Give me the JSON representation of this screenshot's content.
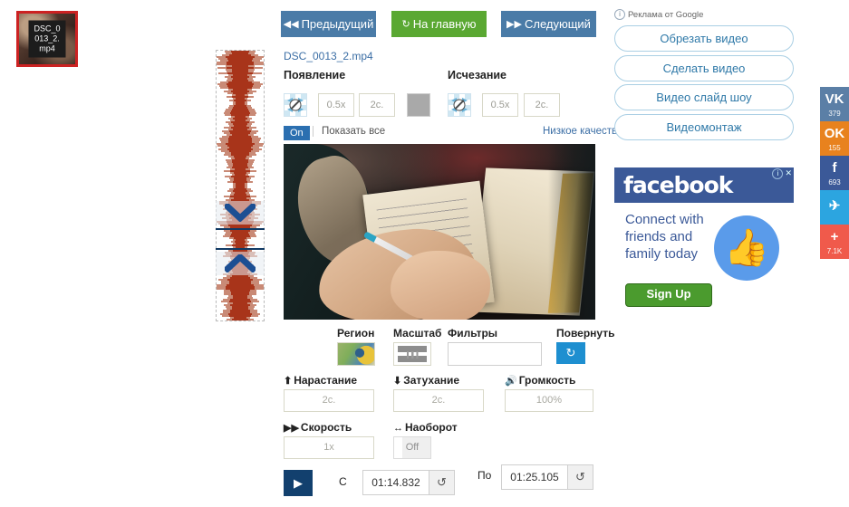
{
  "thumbnail": {
    "caption": "DSC_0\n013_2.\nmp4",
    "border_color": "#cc2222"
  },
  "topnav": {
    "prev": {
      "label": "Предыдущий",
      "icon": "double-left-arrow-icon",
      "color": "#4a7ba7"
    },
    "home": {
      "label": "На главную",
      "icon": "refresh-icon",
      "color": "#5aa832"
    },
    "next": {
      "label": "Следующий",
      "icon": "double-right-arrow-icon",
      "color": "#4a7ba7"
    }
  },
  "file": {
    "name": "DSC_0013_2.mp4"
  },
  "transitions": {
    "appear_label": "Появление",
    "disappear_label": "Исчезание",
    "appear": {
      "icon": "no-transition-icon",
      "speed": "0.5x",
      "duration": "2с."
    },
    "disappear": {
      "icon": "no-transition-icon",
      "speed": "0.5x",
      "duration": "2с."
    }
  },
  "options": {
    "on_badge": "On",
    "show_all": "Показать все",
    "low_quality": "Низкое качество?"
  },
  "controls": {
    "region_label": "Регион",
    "scale_label": "Масштаб",
    "filters_label": "Фильтры",
    "filters_value": "",
    "rotate_label": "Повернуть",
    "rotate_icon": "rotate-icon"
  },
  "audio": {
    "rise_label": "Нарастание",
    "rise_icon": "arrow-up-icon",
    "rise_value": "2с.",
    "fall_label": "Затухание",
    "fall_icon": "arrow-down-icon",
    "fall_value": "2с.",
    "volume_label": "Громкость",
    "volume_icon": "speaker-icon",
    "volume_value": "100%",
    "speed_label": "Скорость",
    "speed_icon": "fast-forward-icon",
    "speed_value": "1x",
    "reverse_label": "Наоборот",
    "reverse_icon": "left-right-arrow-icon",
    "reverse_value": "Off"
  },
  "playback": {
    "play_icon": "play-icon",
    "from_label": "С",
    "from_value": "01:14.832",
    "to_label": "По",
    "to_value": "01:25.105",
    "refresh_icon": "refresh-icon"
  },
  "ads": {
    "label": "Реклама от Google",
    "info_icon": "info-icon",
    "buttons": [
      {
        "label": "Обрезать видео"
      },
      {
        "label": "Сделать видео"
      },
      {
        "label": "Видео слайд шоу"
      },
      {
        "label": "Видеомонтаж"
      }
    ],
    "facebook": {
      "logo": "facebook",
      "text": "Connect with friends and family today",
      "cta": "Sign Up",
      "thumb_icon": "thumbs-up-icon",
      "info_icon": "info-icon",
      "close_icon": "close-icon"
    }
  },
  "social": [
    {
      "name": "vk",
      "glyph": "VK",
      "count": "379",
      "color": "#5b7fa6"
    },
    {
      "name": "odnoklassniki",
      "glyph": "OK",
      "count": "155",
      "color": "#e8821e"
    },
    {
      "name": "facebook",
      "glyph": "f",
      "count": "693",
      "color": "#3b5998"
    },
    {
      "name": "twitter",
      "glyph": "✈",
      "count": "",
      "color": "#2ca5e0"
    },
    {
      "name": "more",
      "glyph": "+",
      "count": "7.1K",
      "color": "#f05a4b"
    }
  ]
}
